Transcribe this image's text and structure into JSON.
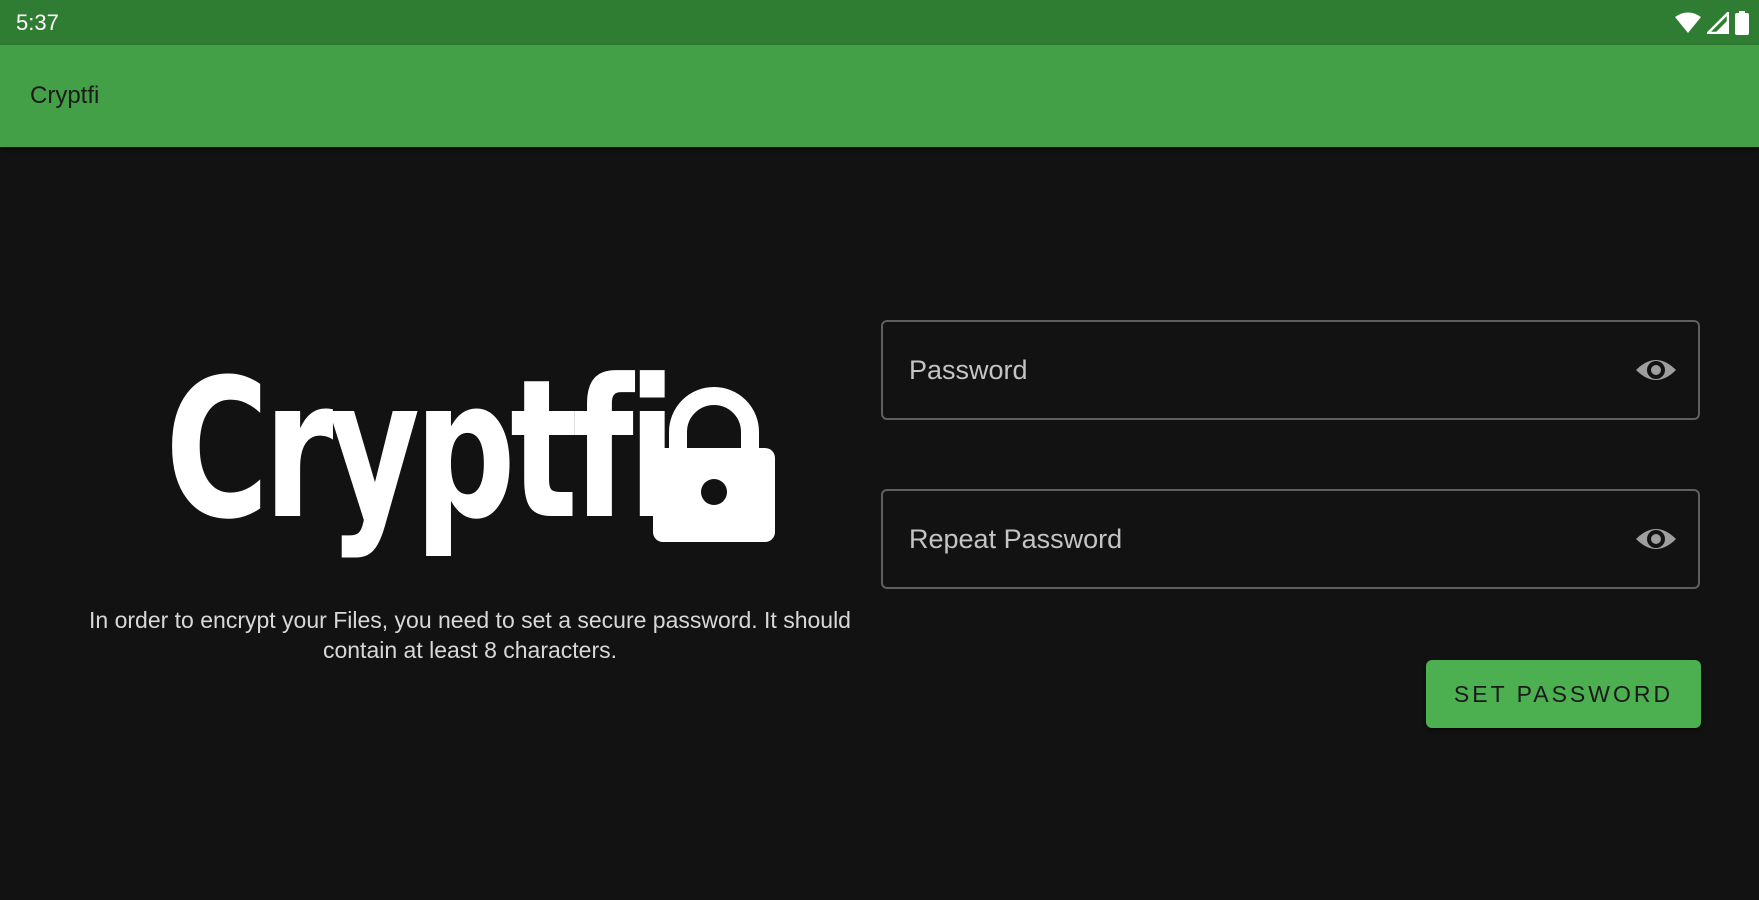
{
  "status_bar": {
    "time": "5:37",
    "icons": [
      "wifi-icon",
      "signal-icon",
      "battery-icon"
    ]
  },
  "app_bar": {
    "title": "Cryptfi"
  },
  "logo": {
    "text": "Cryptfi",
    "icon": "lock-icon"
  },
  "description": "In order to encrypt your Files, you need to set a secure password. It should contain at least 8 characters.",
  "form": {
    "password": {
      "placeholder": "Password",
      "value": "",
      "icon": "eye-icon"
    },
    "repeat_password": {
      "placeholder": "Repeat Password",
      "value": "",
      "icon": "eye-icon"
    },
    "submit_label": "SET PASSWORD"
  },
  "colors": {
    "status_bar": "#2e7d32",
    "app_bar": "#43a047",
    "button": "#4caf50",
    "background": "#121212"
  }
}
